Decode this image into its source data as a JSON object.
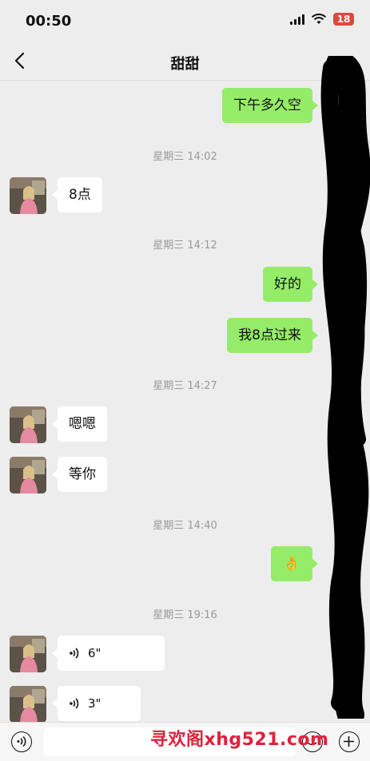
{
  "status": {
    "time": "00:50",
    "battery": "18",
    "battery_color": "#e4463d"
  },
  "header": {
    "title": "甜甜"
  },
  "conversation": {
    "timestamps": [
      "星期三 14:02",
      "星期三 14:12",
      "星期三 14:27",
      "星期三 14:40",
      "星期三 19:16"
    ],
    "messages": [
      {
        "side": "out",
        "type": "text",
        "text": "下午多久空"
      },
      {
        "side": "in",
        "type": "text",
        "text": "8点"
      },
      {
        "side": "out",
        "type": "text",
        "text": "好的"
      },
      {
        "side": "out",
        "type": "text",
        "text": "我8点过来"
      },
      {
        "side": "in",
        "type": "text",
        "text": "嗯嗯"
      },
      {
        "side": "in",
        "type": "text",
        "text": "等你"
      },
      {
        "side": "out",
        "type": "emoji",
        "text": "👌"
      },
      {
        "side": "in",
        "type": "voice",
        "text": "6\""
      },
      {
        "side": "in",
        "type": "voice",
        "text": "3\""
      }
    ]
  },
  "input": {
    "voice_icon": "voice-toggle-icon",
    "emoji_icon": "emoji-icon",
    "plus_icon": "plus-icon"
  },
  "watermark": "寻欢阁xhg521.com",
  "colors": {
    "background": "#ededed",
    "outgoing_bubble": "#95ec69",
    "incoming_bubble": "#ffffff",
    "watermark": "#e0213b"
  }
}
